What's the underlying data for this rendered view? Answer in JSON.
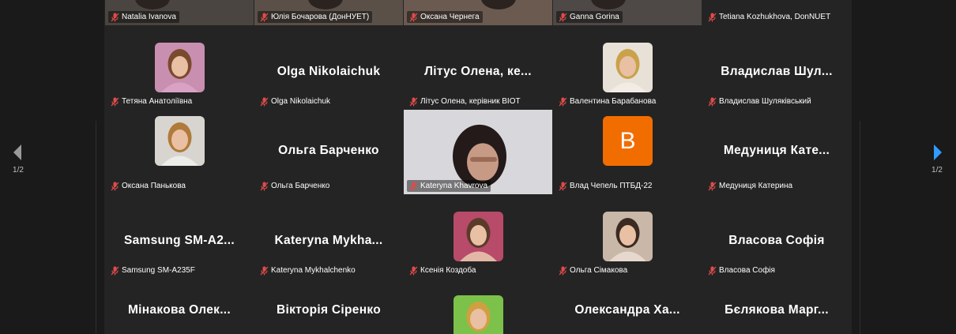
{
  "pagination": {
    "left_indicator": "1/2",
    "right_indicator": "1/2"
  },
  "colors": {
    "active_speaker": "#23d959",
    "avatar_orange": "#f26d00",
    "muted_mic": "#e04b4b"
  },
  "participants": [
    {
      "label": "Natalia Ivanova",
      "big": "",
      "type": "video",
      "active": true
    },
    {
      "label": "Юлія Бочарова (ДонНУЕТ)",
      "big": "",
      "type": "video"
    },
    {
      "label": "Оксана Чернега",
      "big": "",
      "type": "video"
    },
    {
      "label": "Ganna Gorina",
      "big": "",
      "type": "video"
    },
    {
      "label": "Tetiana Kozhukhova, DonNUET",
      "big": "",
      "type": "name"
    },
    {
      "label": "Тетяна Анатоліївна",
      "big": "",
      "type": "photo"
    },
    {
      "label": "Olga Nikolaichuk",
      "big": "Olga Nikolaichuk",
      "type": "name"
    },
    {
      "label": "Літус Олена, керівник BIOT",
      "big": "Літус Олена, ке...",
      "type": "name"
    },
    {
      "label": "Валентина Барабанова",
      "big": "",
      "type": "photo"
    },
    {
      "label": "Владислав Шуляківський",
      "big": "Владислав Шул...",
      "type": "name"
    },
    {
      "label": "Оксана Панькова",
      "big": "",
      "type": "photo"
    },
    {
      "label": "Ольга Барченко",
      "big": "Ольга Барченко",
      "type": "name"
    },
    {
      "label": "Kateryna Khavrova",
      "big": "",
      "type": "video"
    },
    {
      "label": "Влад Чепель ПТБД-22",
      "big": "",
      "type": "letter",
      "letter": "B"
    },
    {
      "label": "Медуниця Катерина",
      "big": "Медуниця Кате...",
      "type": "name"
    },
    {
      "label": "Samsung SM-A235F",
      "big": "Samsung SM-A2...",
      "type": "name"
    },
    {
      "label": "Kateryna Mykhalchenko",
      "big": "Kateryna Mykha...",
      "type": "name"
    },
    {
      "label": "Ксенія Коздоба",
      "big": "",
      "type": "photo"
    },
    {
      "label": "Ольга Сімакова",
      "big": "",
      "type": "photo"
    },
    {
      "label": "Власова Софія",
      "big": "Власова Софія",
      "type": "name"
    },
    {
      "label": "",
      "big": "Мінакова Олек...",
      "type": "name"
    },
    {
      "label": "",
      "big": "Вікторія Сіренко",
      "type": "name"
    },
    {
      "label": "",
      "big": "",
      "type": "photo"
    },
    {
      "label": "",
      "big": "Олександра Ха...",
      "type": "name"
    },
    {
      "label": "",
      "big": "Бєлякова Марг...",
      "type": "name"
    }
  ]
}
